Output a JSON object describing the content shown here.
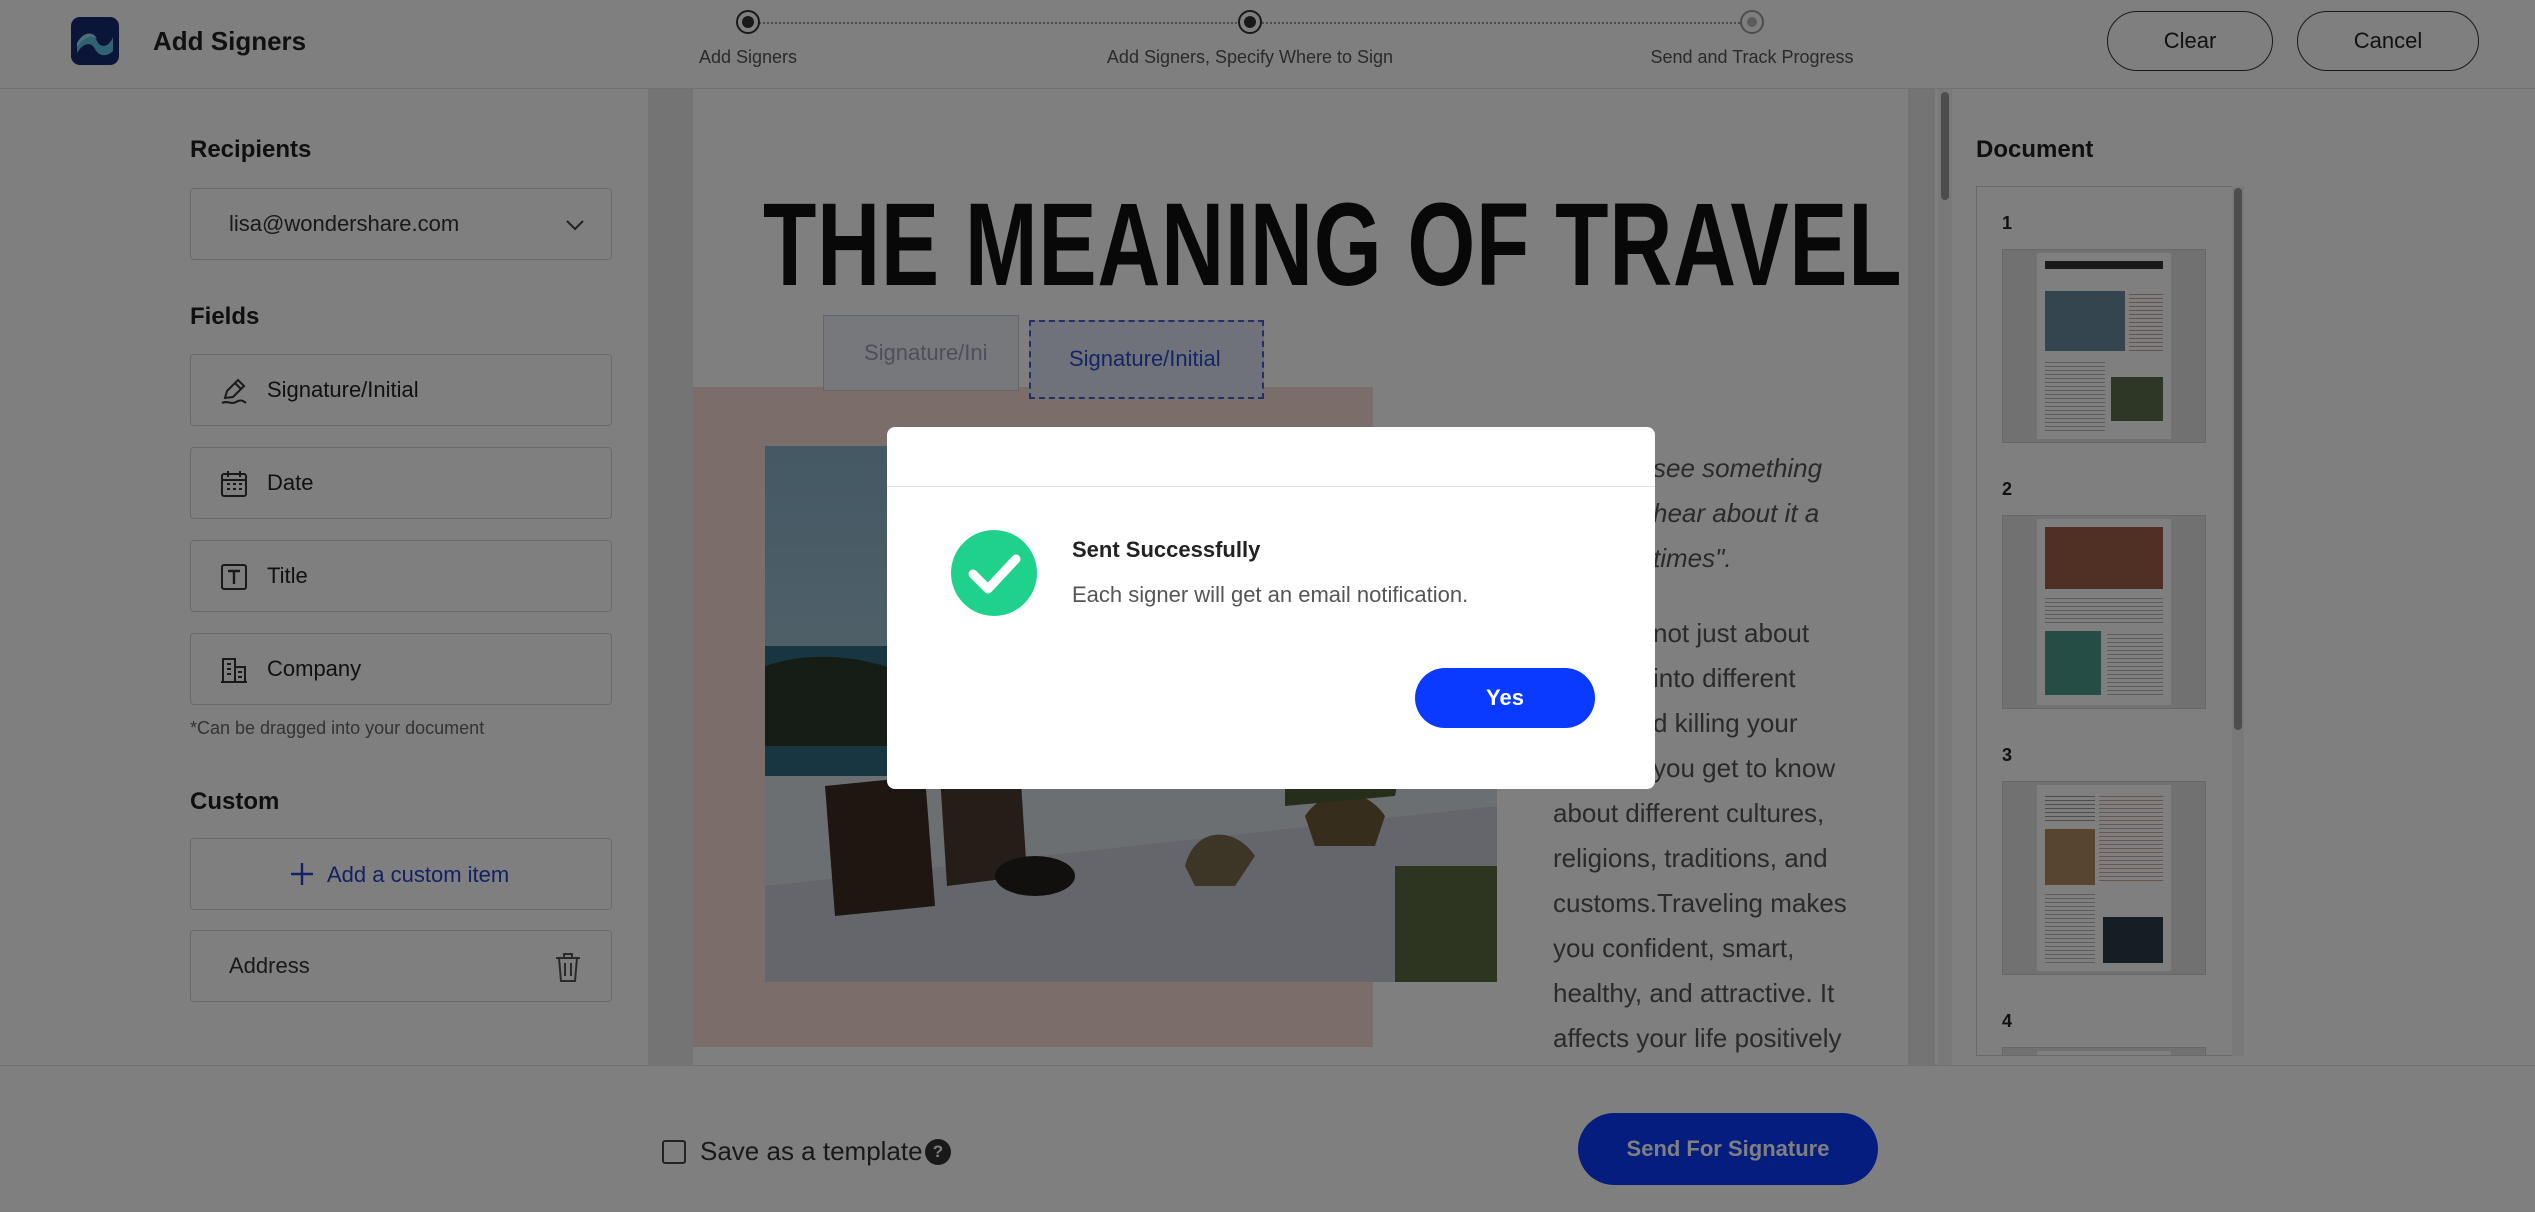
{
  "header": {
    "title": "Add Signers",
    "steps": [
      {
        "label": "Add Signers",
        "status": "complete"
      },
      {
        "label": "Add Signers, Specify Where to Sign",
        "status": "complete"
      },
      {
        "label": "Send and Track Progress",
        "status": "pending"
      }
    ],
    "clear_label": "Clear",
    "cancel_label": "Cancel"
  },
  "left": {
    "recipients_title": "Recipients",
    "recipient_selected": "lisa@wondershare.com",
    "fields_title": "Fields",
    "fields": [
      {
        "label": "Signature/Initial",
        "icon": "signature-pen-icon"
      },
      {
        "label": "Date",
        "icon": "calendar-icon"
      },
      {
        "label": "Title",
        "icon": "text-t-icon"
      },
      {
        "label": "Company",
        "icon": "building-icon"
      }
    ],
    "drag_note": "*Can be dragged into your document",
    "custom_title": "Custom",
    "add_custom_label": "Add a custom item",
    "custom_items": [
      {
        "label": "Address",
        "icon": "trash-icon"
      }
    ]
  },
  "document": {
    "title": "THE MEANING OF TRAVELING",
    "signature_fields": [
      "Signature/Ini",
      "Signature/Initial"
    ],
    "quote_lines": [
      "see something",
      "hear about it a",
      "times\"."
    ],
    "body_lines": [
      "not just about",
      "into different",
      "d killing your",
      "you get to know",
      "about different cultures,",
      "religions, traditions, and",
      "customs.Traveling makes",
      "you confident, smart,",
      "healthy, and attractive. It",
      "affects your life positively"
    ]
  },
  "right": {
    "title": "Document",
    "pages": [
      "1",
      "2",
      "3",
      "4"
    ]
  },
  "bottom": {
    "save_template_label": "Save as a template",
    "save_template_checked": false,
    "help_glyph": "?",
    "send_label": "Send For Signature"
  },
  "modal": {
    "title": "Sent Successfully",
    "message": "Each signer will get an email notification.",
    "yes_label": "Yes",
    "icon": "success-check-icon"
  },
  "colors": {
    "primary": "#0a3aff",
    "success": "#1fd18b",
    "logo_bg": "#142a6e"
  }
}
